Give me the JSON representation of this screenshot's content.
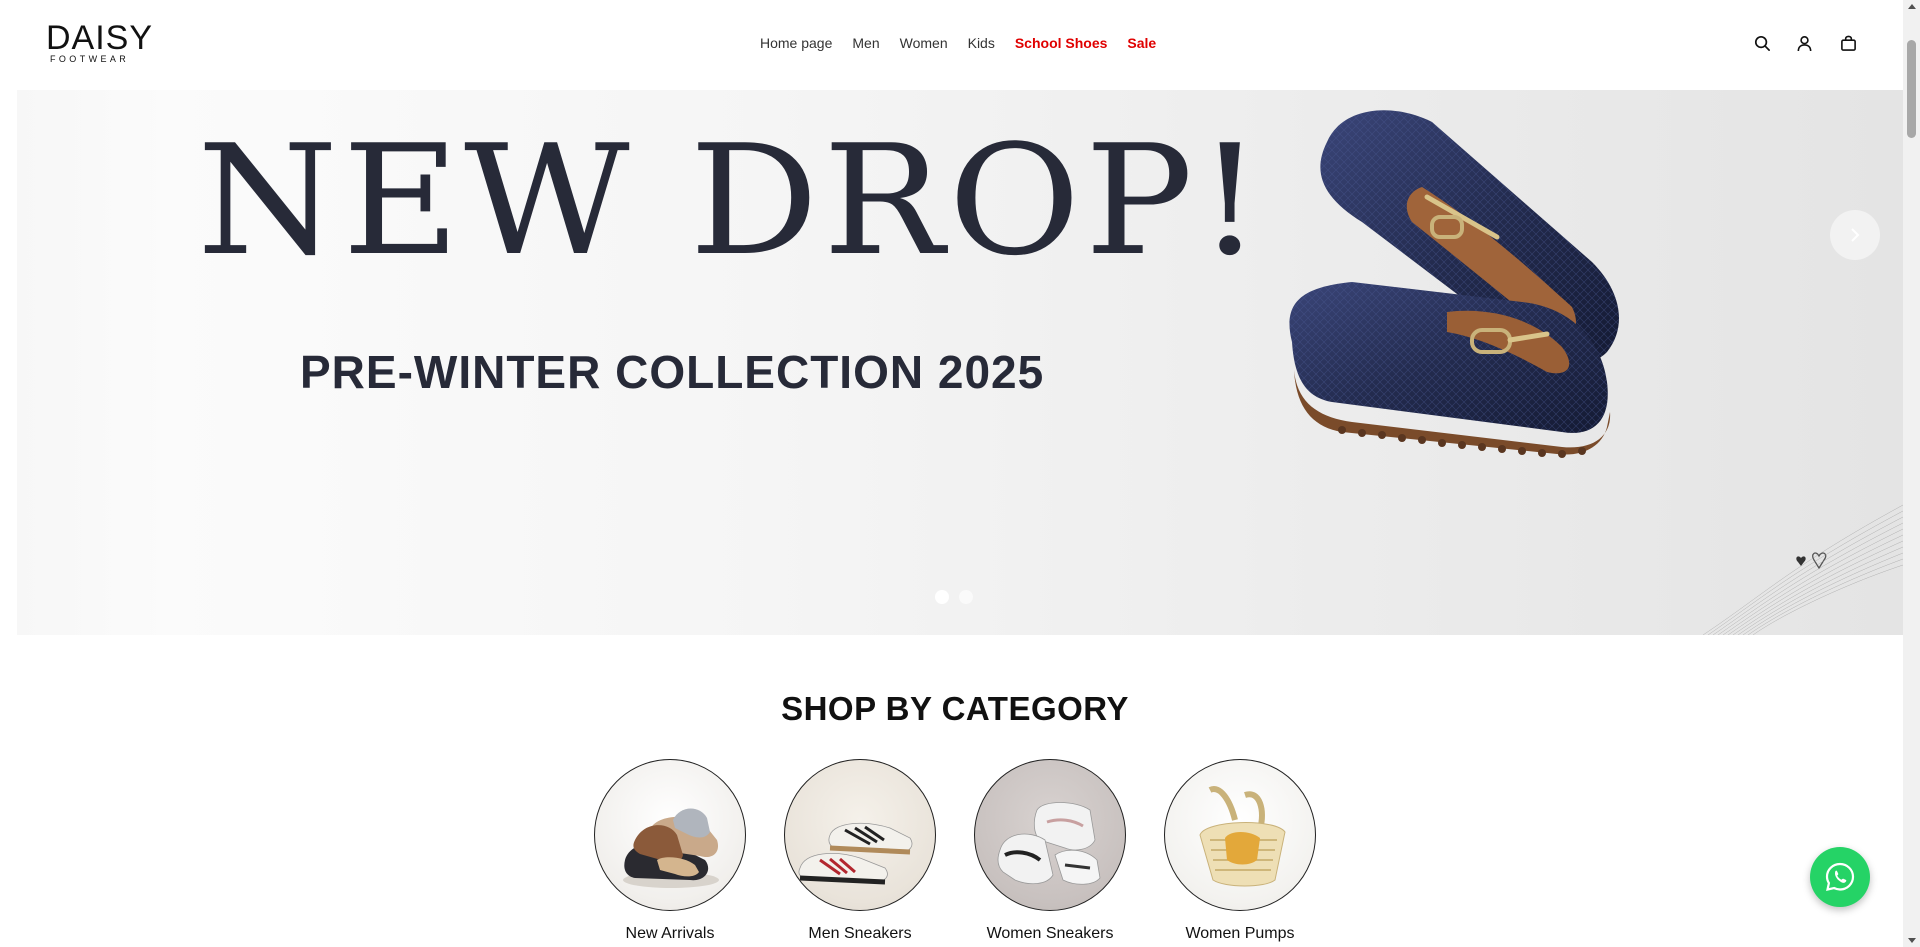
{
  "brand": {
    "name": "DAISY",
    "sub": "FOOTWEAR"
  },
  "nav": {
    "items": [
      {
        "label": "Home page"
      },
      {
        "label": "Men"
      },
      {
        "label": "Women"
      },
      {
        "label": "Kids"
      },
      {
        "label": "School Shoes"
      },
      {
        "label": "Sale"
      }
    ],
    "highlight_color": "#e00000"
  },
  "header_icons": [
    "search-icon",
    "account-icon",
    "cart-icon"
  ],
  "hero": {
    "headline": "NEW DROP!",
    "subheadline": "PRE-WINTER COLLECTION 2025",
    "slides": 2,
    "active_slide": 1,
    "text_color": "#272a38",
    "shoe_color": "#232b4e"
  },
  "categories_section": {
    "title": "SHOP BY CATEGORY",
    "items": [
      {
        "label": "New Arrivals"
      },
      {
        "label": "Men Sneakers"
      },
      {
        "label": "Women Sneakers"
      },
      {
        "label": "Women Pumps"
      }
    ]
  },
  "whatsapp": {
    "icon": "whatsapp-icon",
    "color": "#25d366"
  }
}
